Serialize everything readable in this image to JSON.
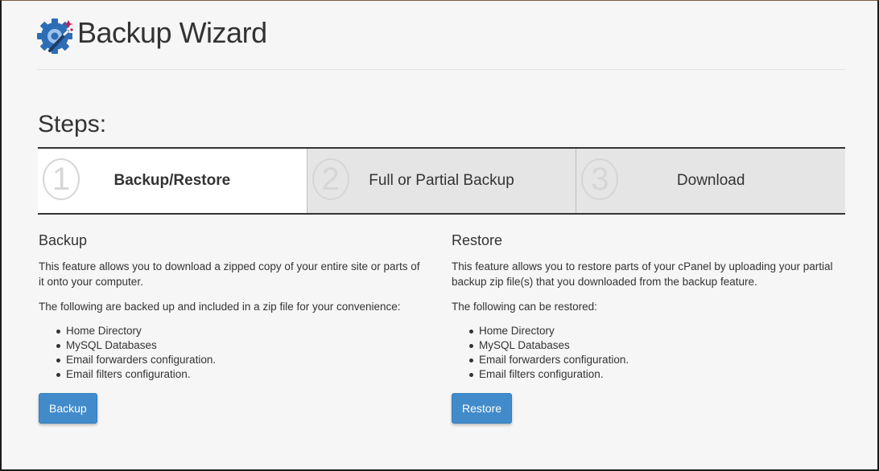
{
  "header": {
    "title": "Backup Wizard",
    "icon": "gear-wand-icon"
  },
  "steps_heading": "Steps:",
  "steps": [
    {
      "number": "1",
      "label": "Backup/Restore",
      "active": true
    },
    {
      "number": "2",
      "label": "Full or Partial Backup",
      "active": false
    },
    {
      "number": "3",
      "label": "Download",
      "active": false
    }
  ],
  "backup": {
    "heading": "Backup",
    "description": "This feature allows you to download a zipped copy of your entire site or parts of it onto your computer.",
    "list_intro": "The following are backed up and included in a zip file for your convenience:",
    "items": [
      "Home Directory",
      "MySQL Databases",
      "Email forwarders configuration.",
      "Email filters configuration."
    ],
    "button_label": "Backup"
  },
  "restore": {
    "heading": "Restore",
    "description": "This feature allows you to restore parts of your cPanel by uploading your partial backup zip file(s) that you downloaded from the backup feature.",
    "list_intro": "The following can be restored:",
    "items": [
      "Home Directory",
      "MySQL Databases",
      "Email forwarders configuration.",
      "Email filters configuration."
    ],
    "button_label": "Restore"
  },
  "colors": {
    "primary_button": "#428bca",
    "inactive_step": "#e5e5e5",
    "active_step": "#ffffff"
  }
}
